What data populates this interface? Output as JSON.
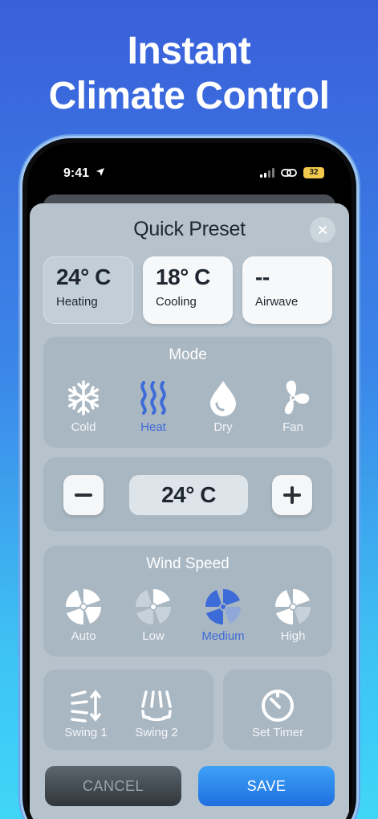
{
  "headline": {
    "line1": "Instant",
    "line2": "Climate Control"
  },
  "status_bar": {
    "time": "9:41",
    "battery": "32"
  },
  "sheet": {
    "title": "Quick Preset"
  },
  "presets": [
    {
      "temp": "24° C",
      "label": "Heating",
      "active": true
    },
    {
      "temp": "18° C",
      "label": "Cooling",
      "active": false
    },
    {
      "temp": "--",
      "label": "Airwave",
      "active": false
    }
  ],
  "mode": {
    "title": "Mode",
    "options": [
      {
        "label": "Cold",
        "icon": "snowflake-icon"
      },
      {
        "label": "Heat",
        "icon": "heat-waves-icon",
        "selected": true
      },
      {
        "label": "Dry",
        "icon": "droplet-icon"
      },
      {
        "label": "Fan",
        "icon": "fan-icon"
      }
    ]
  },
  "temperature": {
    "value": "24° C"
  },
  "wind_speed": {
    "title": "Wind Speed",
    "options": [
      {
        "label": "Auto"
      },
      {
        "label": "Low"
      },
      {
        "label": "Medium",
        "selected": true
      },
      {
        "label": "High"
      }
    ]
  },
  "swing": {
    "swing1": "Swing 1",
    "swing2": "Swing 2"
  },
  "timer": {
    "label": "Set Timer"
  },
  "actions": {
    "cancel": "CANCEL",
    "save": "SAVE"
  },
  "colors": {
    "accent": "#3d6bd8",
    "save": "#2b86ec",
    "sheet": "#b6c3cd"
  }
}
